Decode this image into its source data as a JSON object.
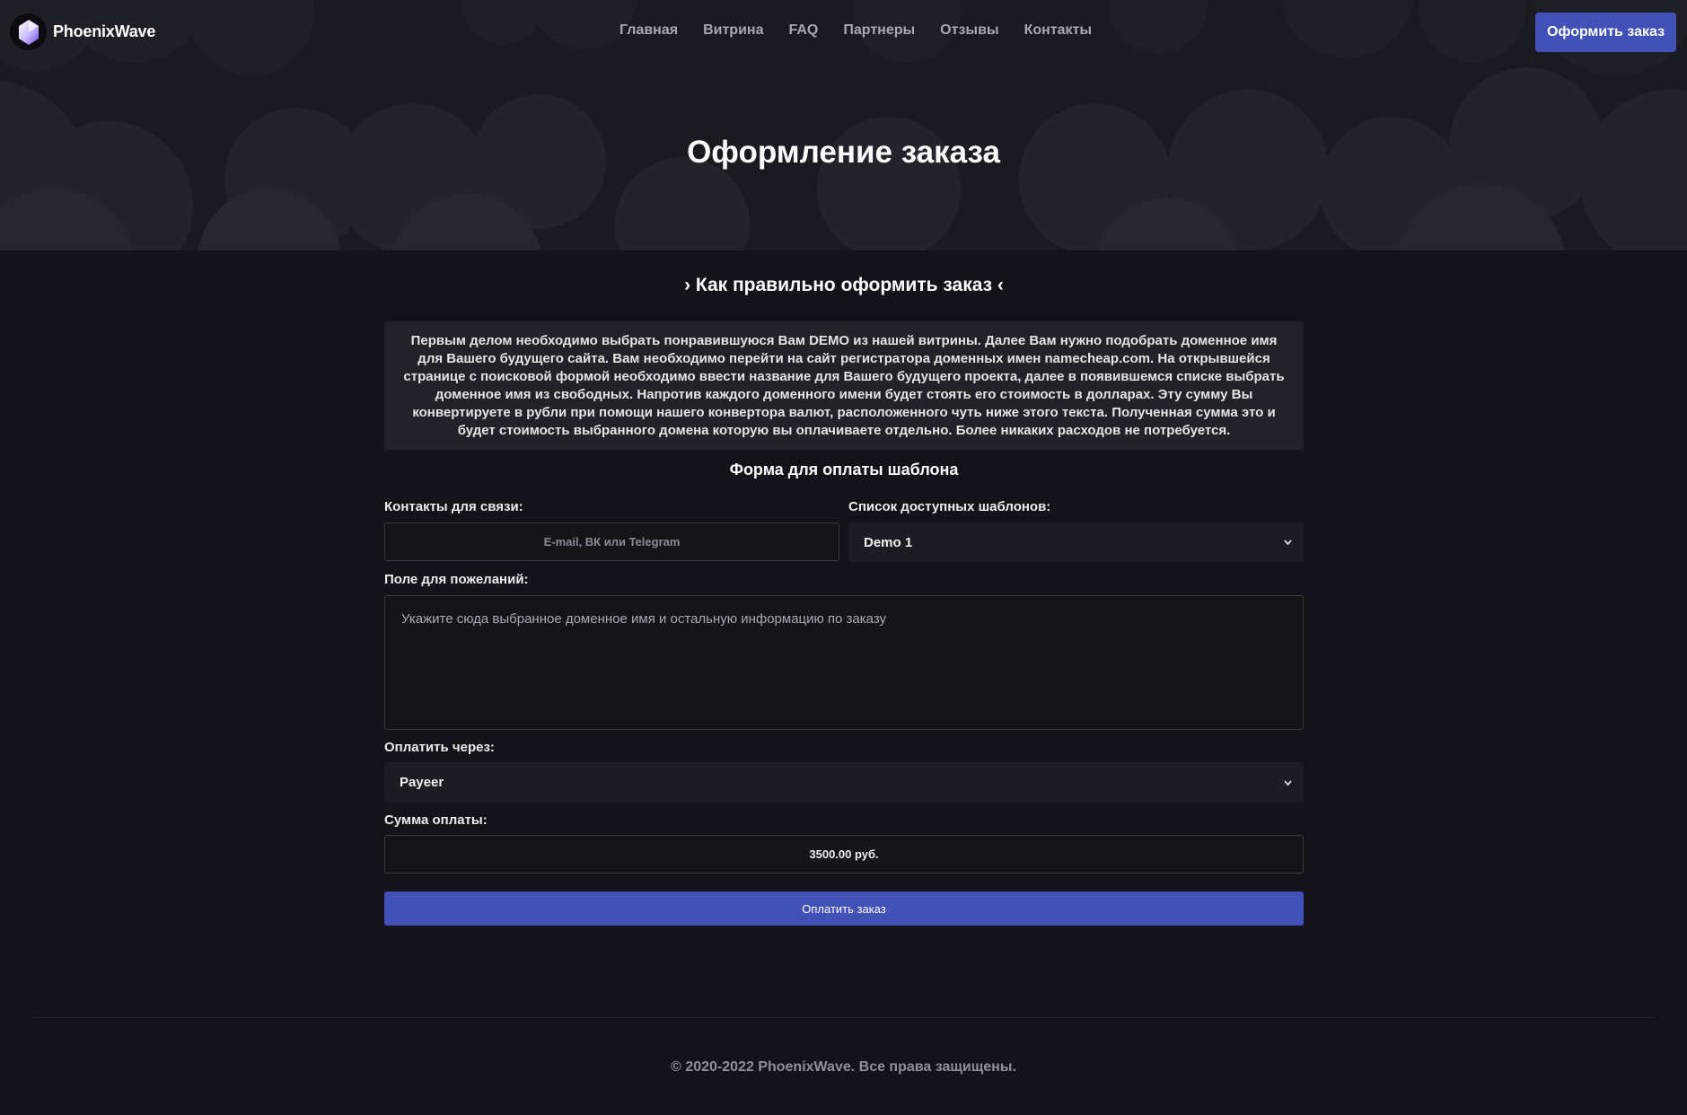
{
  "brand": {
    "name": "PhoenixWave"
  },
  "nav": {
    "items": [
      "Главная",
      "Витрина",
      "FAQ",
      "Партнеры",
      "Отзывы",
      "Контакты"
    ],
    "cta_label": "Оформить заказ"
  },
  "hero": {
    "title": "Оформление заказа"
  },
  "guide": {
    "title": "› Как правильно оформить заказ ‹",
    "text": "Первым делом необходимо выбрать понравившуюся Вам DEMO из нашей витрины. Далее Вам нужно подобрать доменное имя для Вашего будущего сайта. Вам необходимо перейти на сайт регистратора доменных имен namecheap.com. На открывшейся странице с поисковой формой необходимо ввести название для Вашего будущего проекта, далее в появившемся списке выбрать доменное имя из свободных. Напротив каждого доменного имени будет стоять его стоимость в долларах. Эту сумму Вы конвертируете в рубли при помощи нашего конвертора валют, расположенного чуть ниже этого текста. Полученная сумма это и будет стоимость выбранного домена которую вы оплачиваете отдельно. Более никаких расходов не потребуется."
  },
  "form": {
    "title": "Форма для оплаты шаблона",
    "contacts_label": "Контакты для связи:",
    "contacts_placeholder": "E-mail, ВК или Telegram",
    "templates_label": "Список доступных шаблонов:",
    "templates_selected": "Demo 1",
    "wishes_label": "Поле для пожеланий:",
    "wishes_placeholder": "Укажите сюда выбранное доменное имя и остальную информацию по заказу",
    "payment_label": "Оплатить через:",
    "payment_selected": "Payeer",
    "amount_label": "Сумма оплаты:",
    "amount_value": "3500.00 руб.",
    "submit_label": "Оплатить заказ"
  },
  "footer": {
    "copyright": "© 2020-2022 PhoenixWave. Все права защищены."
  },
  "colors": {
    "accent": "#4251b8",
    "page_bg": "#131319",
    "hero_bg": "#1a1a21",
    "panel_bg": "#222228"
  },
  "icons": [
    "phoenix-logo-icon",
    "chevron-down-icon"
  ]
}
